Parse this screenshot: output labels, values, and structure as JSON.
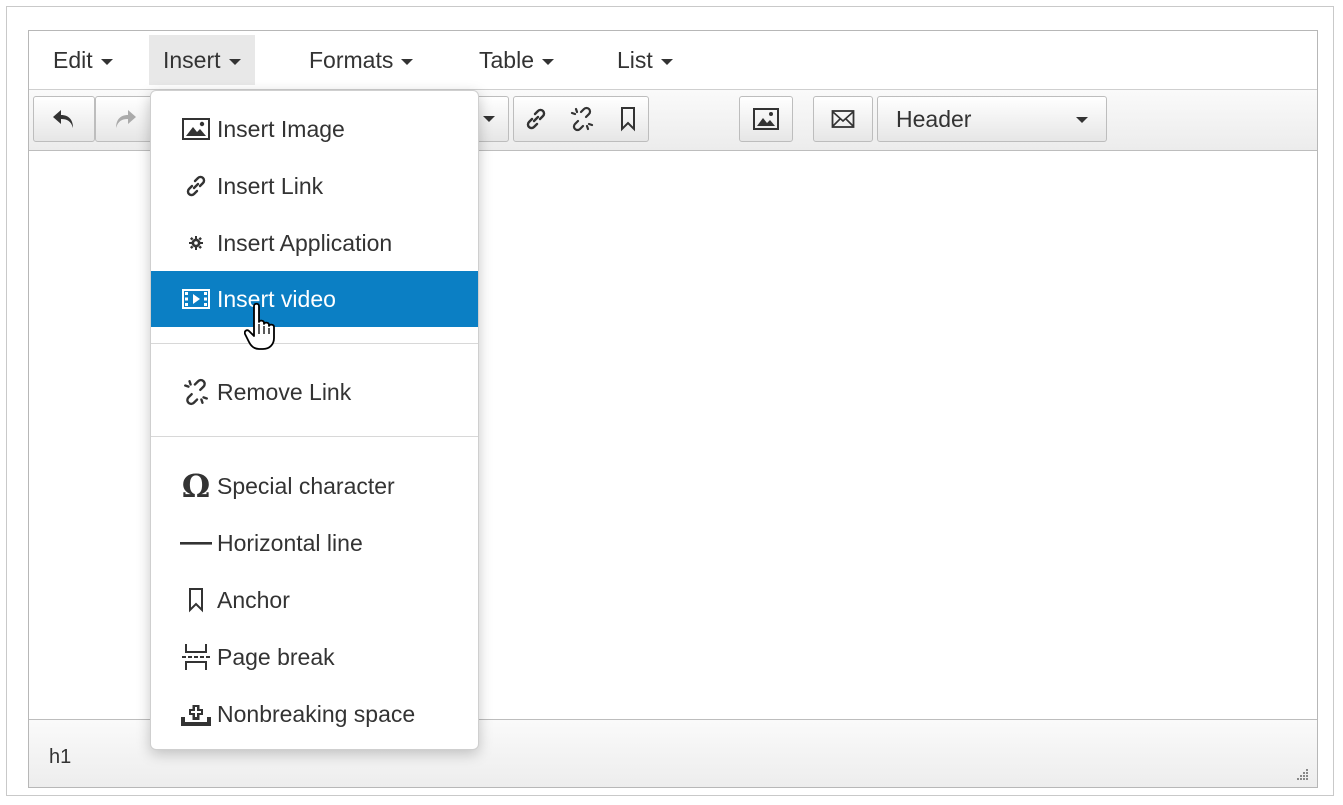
{
  "menubar": {
    "items": [
      {
        "label": "Edit"
      },
      {
        "label": "Insert"
      },
      {
        "label": "Formats"
      },
      {
        "label": "Table"
      },
      {
        "label": "List"
      }
    ]
  },
  "toolbar": {
    "icons": [
      "undo-icon",
      "redo-icon",
      "link-icon",
      "unlink-icon",
      "bookmark-icon",
      "image-icon",
      "envelope-icon"
    ],
    "format_select": "Header"
  },
  "insert_menu": {
    "items": [
      {
        "label": "Insert Image",
        "icon": "image-icon"
      },
      {
        "label": "Insert Link",
        "icon": "link-icon"
      },
      {
        "label": "Insert Application",
        "icon": "gear-icon"
      },
      {
        "label": "Insert video",
        "icon": "film-icon",
        "highlighted": true
      },
      {
        "label": "Remove Link",
        "icon": "unlink-icon"
      },
      {
        "label": "Special character",
        "icon": "omega-icon"
      },
      {
        "label": "Horizontal line",
        "icon": "horizontal-line-icon"
      },
      {
        "label": "Anchor",
        "icon": "bookmark-icon"
      },
      {
        "label": "Page break",
        "icon": "page-break-icon"
      },
      {
        "label": "Nonbreaking space",
        "icon": "nbsp-icon"
      }
    ]
  },
  "statusbar": {
    "path": "h1"
  },
  "colors": {
    "highlight": "#0b7fc4",
    "menu_active_bg": "#e8e8e8"
  }
}
